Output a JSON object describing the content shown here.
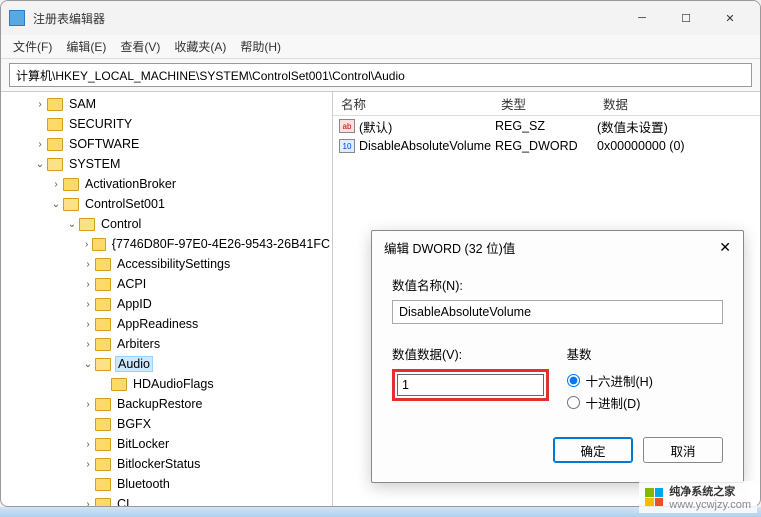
{
  "window": {
    "title": "注册表编辑器"
  },
  "menu": {
    "file": "文件(F)",
    "edit": "编辑(E)",
    "view": "查看(V)",
    "fav": "收藏夹(A)",
    "help": "帮助(H)"
  },
  "address": "计算机\\HKEY_LOCAL_MACHINE\\SYSTEM\\ControlSet001\\Control\\Audio",
  "tree": [
    {
      "d": 2,
      "t": ">",
      "l": "SAM"
    },
    {
      "d": 2,
      "t": "",
      "l": "SECURITY"
    },
    {
      "d": 2,
      "t": ">",
      "l": "SOFTWARE"
    },
    {
      "d": 2,
      "t": "v",
      "l": "SYSTEM",
      "open": true
    },
    {
      "d": 3,
      "t": ">",
      "l": "ActivationBroker"
    },
    {
      "d": 3,
      "t": "v",
      "l": "ControlSet001",
      "open": true
    },
    {
      "d": 4,
      "t": "v",
      "l": "Control",
      "open": true
    },
    {
      "d": 5,
      "t": ">",
      "l": "{7746D80F-97E0-4E26-9543-26B41FC"
    },
    {
      "d": 5,
      "t": ">",
      "l": "AccessibilitySettings"
    },
    {
      "d": 5,
      "t": ">",
      "l": "ACPI"
    },
    {
      "d": 5,
      "t": ">",
      "l": "AppID"
    },
    {
      "d": 5,
      "t": ">",
      "l": "AppReadiness"
    },
    {
      "d": 5,
      "t": ">",
      "l": "Arbiters"
    },
    {
      "d": 5,
      "t": "v",
      "l": "Audio",
      "open": true,
      "sel": true
    },
    {
      "d": 6,
      "t": "",
      "l": "HDAudioFlags"
    },
    {
      "d": 5,
      "t": ">",
      "l": "BackupRestore"
    },
    {
      "d": 5,
      "t": "",
      "l": "BGFX"
    },
    {
      "d": 5,
      "t": ">",
      "l": "BitLocker"
    },
    {
      "d": 5,
      "t": ">",
      "l": "BitlockerStatus"
    },
    {
      "d": 5,
      "t": "",
      "l": "Bluetooth"
    },
    {
      "d": 5,
      "t": ">",
      "l": "CI"
    }
  ],
  "list": {
    "headers": {
      "name": "名称",
      "type": "类型",
      "data": "数据"
    },
    "rows": [
      {
        "icon": "str",
        "name": "(默认)",
        "type": "REG_SZ",
        "data": "(数值未设置)"
      },
      {
        "icon": "dw",
        "name": "DisableAbsoluteVolume",
        "type": "REG_DWORD",
        "data": "0x00000000 (0)"
      }
    ]
  },
  "modal": {
    "title": "编辑 DWORD (32 位)值",
    "name_label": "数值名称(N):",
    "name_value": "DisableAbsoluteVolume",
    "data_label": "数值数据(V):",
    "data_value": "1",
    "base_label": "基数",
    "hex": "十六进制(H)",
    "dec": "十进制(D)",
    "ok": "确定",
    "cancel": "取消"
  },
  "watermark": {
    "brand": "纯净系统之家",
    "url": "www.ycwjzy.com"
  }
}
